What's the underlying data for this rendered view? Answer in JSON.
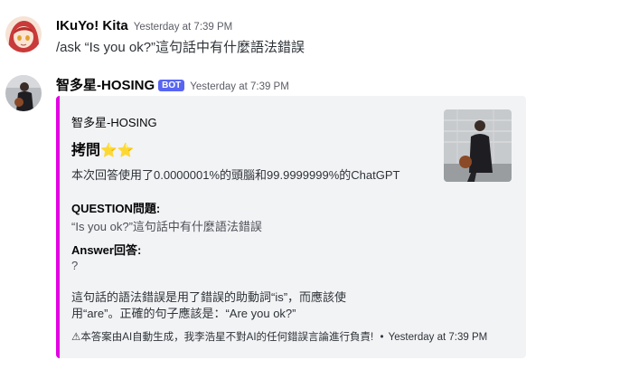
{
  "messages": [
    {
      "username": "IKuYo! Kita",
      "timestamp": "Yesterday at 7:39 PM",
      "content": "/ask “Is you ok?”這句話中有什麼語法錯誤",
      "avatar_icon": "anime-avatar"
    },
    {
      "username": "智多星-HOSING",
      "badge": "BOT",
      "timestamp": "Yesterday at 7:39 PM",
      "avatar_icon": "photo-avatar"
    }
  ],
  "embed": {
    "accent_color": "#e400e4",
    "author": "智多星-HOSING",
    "title": "拷問",
    "title_emoji": "⭐⭐",
    "description": "本次回答使用了0.0000001%的頭腦和99.9999999%的ChatGPT",
    "fields": [
      {
        "name": "QUESTION問題:",
        "value": "“Is you ok?”這句話中有什麼語法錯誤"
      },
      {
        "name": "Answer回答:",
        "value": "?"
      }
    ],
    "answer_text": "這句話的語法錯誤是用了錯誤的助動詞“is”，而應該使用“are”。正確的句子應該是：“Are you ok?”",
    "footer_text": "⚠本答案由AI自動生成，我李浩星不對AI的任何錯誤言論進行負責!",
    "footer_separator": "•",
    "footer_timestamp": "Yesterday at 7:39 PM"
  }
}
